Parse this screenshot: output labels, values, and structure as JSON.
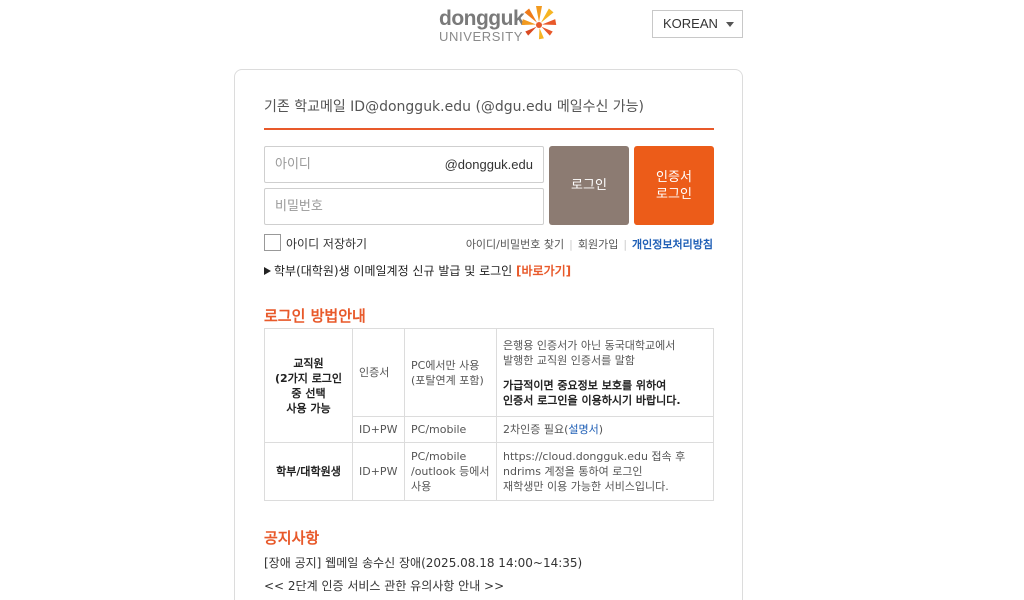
{
  "header": {
    "logo_line1": "dongguk",
    "logo_line2": "UNIVERSITY",
    "language_selected": "KOREAN"
  },
  "login": {
    "title": "기존 학교메일 ID@dongguk.edu (@dgu.edu 메일수신 가능)",
    "id_placeholder": "아이디",
    "id_domain": "@dongguk.edu",
    "pw_placeholder": "비밀번호",
    "login_button": "로그인",
    "cert_button_line1": "인증서",
    "cert_button_line2": "로그인",
    "remember_label": "아이디 저장하기",
    "find_link": "아이디/비밀번호 찾기",
    "signup_link": "회원가입",
    "privacy_link": "개인정보처리방침",
    "new_account_text": "학부(대학원)생 이메일계정 신규 발급 및 로그인",
    "new_account_link": "[바로가기]"
  },
  "guide": {
    "title": "로그인 방법안내",
    "row1_role_l1": "교직원",
    "row1_role_l2": "(2가지 로그인",
    "row1_role_l3": "중 선택",
    "row1_role_l4": "사용 가능",
    "row1_method": "인증서",
    "row1_env_l1": "PC에서만 사용",
    "row1_env_l2": "(포탈연계 포함)",
    "row1_desc_l1": "은행용 인증서가 아닌 동국대학교에서",
    "row1_desc_l2": "발행한 교직원 인증서를 말함",
    "row1_desc_b1": "가급적이면 중요정보 보호를 위하여",
    "row1_desc_b2": "인증서 로그인을 이용하시기 바랍니다.",
    "row2_method": "ID+PW",
    "row2_env": "PC/mobile",
    "row2_desc": "2차인증 필요(",
    "row2_desc_link": "설명서",
    "row2_desc_end": ")",
    "row3_role": "학부/대학원생",
    "row3_method": "ID+PW",
    "row3_env_l1": "PC/mobile",
    "row3_env_l2": "/outlook 등에서",
    "row3_env_l3": "사용",
    "row3_desc_l1": "https://cloud.dongguk.edu 접속 후",
    "row3_desc_l2": "ndrims 계정을 통하여 로그인",
    "row3_desc_l3": "재학생만 이용 가능한 서비스입니다."
  },
  "notices": {
    "title": "공지사항",
    "items": [
      "[장애 공지] 웹메일 송수신 장애(2025.08.18 14:00~14:35)",
      "<< 2단계 인증 서비스 관한 유의사항 안내 >>"
    ]
  },
  "colors": {
    "accent": "#e8592a",
    "login_button": "#8c7b72",
    "cert_button": "#ec5c19",
    "link": "#1f5fb6"
  }
}
